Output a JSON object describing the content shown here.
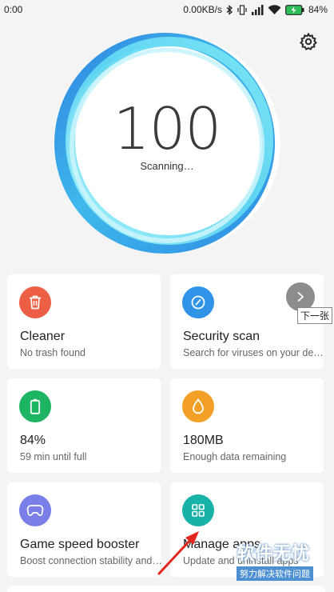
{
  "status_bar": {
    "time": "0:00",
    "network_speed": "0.00KB/s",
    "battery_percent": "84%",
    "icons": [
      "bluetooth-icon",
      "vibrate-icon",
      "signal-icon",
      "wifi-icon",
      "battery-charging-icon"
    ]
  },
  "header": {
    "settings_icon": "gear-icon"
  },
  "score": {
    "value": "100",
    "status": "Scanning…"
  },
  "cards": [
    {
      "title": "Cleaner",
      "subtitle": "No trash found",
      "icon": "trash-icon",
      "color": "#ec5f45"
    },
    {
      "title": "Security scan",
      "subtitle": "Search for viruses on your device",
      "icon": "shield-check-icon",
      "color": "#2f93e8"
    },
    {
      "title": "84%",
      "subtitle": "59 min  until full",
      "icon": "battery-icon",
      "color": "#1db463"
    },
    {
      "title": "180MB",
      "subtitle": "Enough data remaining",
      "icon": "data-drop-icon",
      "color": "#f4a027"
    },
    {
      "title": "Game speed booster",
      "subtitle": "Boost connection stability and speed",
      "icon": "gamepad-icon",
      "color": "#7a7fe8"
    },
    {
      "title": "Manage apps",
      "subtitle": "Update and uninstall apps",
      "icon": "apps-grid-icon",
      "color": "#17b2a8"
    }
  ],
  "overlay": {
    "next_tooltip": "下一张",
    "watermark_main": "软件无忧",
    "watermark_sub": "努力解决软件问题"
  }
}
